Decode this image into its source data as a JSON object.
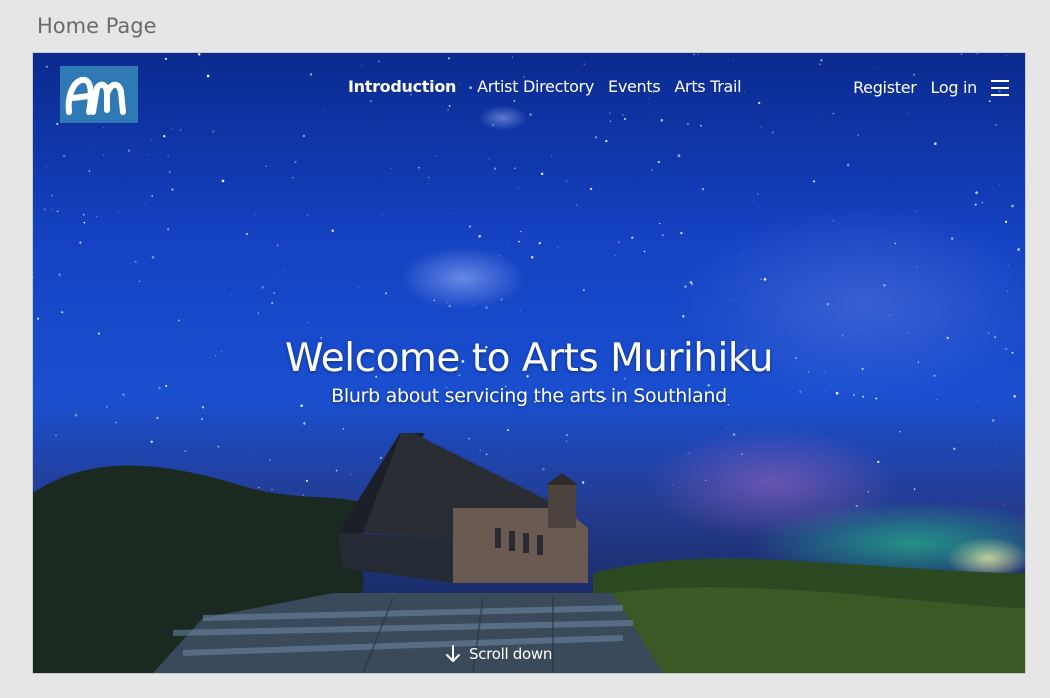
{
  "page_label": "Home Page",
  "nav": {
    "logo_alt": "Arts Murihiku logo",
    "links": [
      {
        "label": "Introduction"
      },
      {
        "label": "Artist Directory"
      },
      {
        "label": "Events"
      },
      {
        "label": "Arts Trail"
      }
    ],
    "register_label": "Register",
    "login_label": "Log in"
  },
  "hero": {
    "title": "Welcome to Arts Murihiku",
    "subtitle": "Blurb about servicing the arts in Southland"
  },
  "scroll": {
    "label": "Scroll down"
  },
  "colors": {
    "logo_bg": "#2f7ab4",
    "sky": "#1a4fd0",
    "page_bg": "#e6e6e6"
  },
  "icons": {
    "menu": "hamburger-menu-icon",
    "scroll": "arrow-down-icon"
  }
}
